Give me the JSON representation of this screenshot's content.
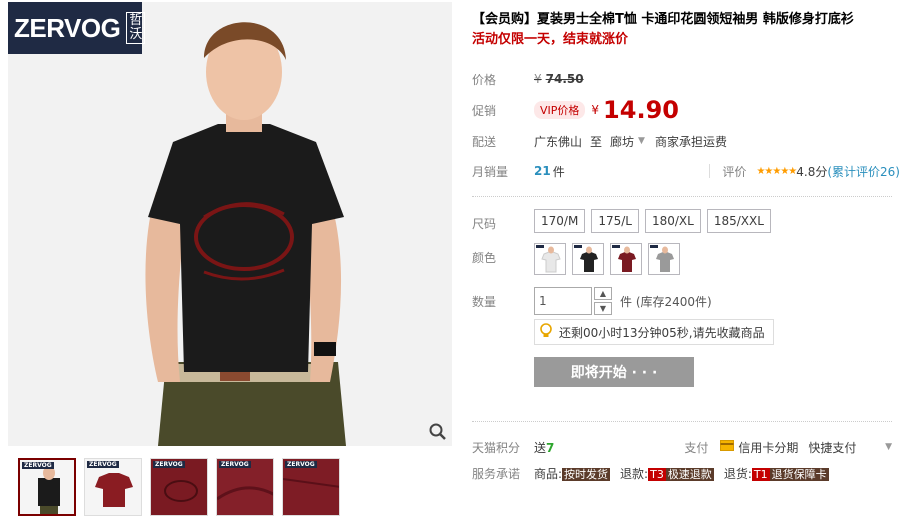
{
  "brand": {
    "logo_text": "ZERVOG",
    "logo_cn": "哲沃"
  },
  "thumbnails": [
    {
      "name": "thumb-front-model",
      "active": true
    },
    {
      "name": "thumb-shirt-flat",
      "active": false
    },
    {
      "name": "thumb-print-detail",
      "active": false
    },
    {
      "name": "thumb-fabric-detail",
      "active": false
    },
    {
      "name": "thumb-hem-detail",
      "active": false
    }
  ],
  "product": {
    "title": "【会员购】夏装男士全棉T恤 卡通印花圆领短袖男 韩版修身打底衫",
    "subtitle": "活动仅限一天，结束就涨价"
  },
  "price": {
    "label": "价格",
    "currency": "¥",
    "original": "74.50"
  },
  "promo": {
    "label": "促销",
    "vip_tag": "VIP价格",
    "currency": "¥",
    "sale": "14.90"
  },
  "shipping": {
    "label": "配送",
    "from": "广东佛山",
    "to_word": "至",
    "to_city": "廊坊",
    "fee_note": "商家承担运费"
  },
  "sales": {
    "label": "月销量",
    "count": "21",
    "unit": "件",
    "review_label": "评价",
    "stars": "★★★★★",
    "rating": "4.8分",
    "review_count": "(累计评价26)"
  },
  "sizes": {
    "label": "尺码",
    "options": [
      "170/M",
      "175/L",
      "180/XL",
      "185/XXL"
    ]
  },
  "colors": {
    "label": "颜色",
    "options": [
      {
        "name": "white",
        "hex": "#e8e8e8"
      },
      {
        "name": "black",
        "hex": "#222222"
      },
      {
        "name": "burgundy",
        "hex": "#7a1a22"
      },
      {
        "name": "gray",
        "hex": "#9a9a9a"
      }
    ]
  },
  "quantity": {
    "label": "数量",
    "value": "1",
    "stock_text": "件 (库存2400件)"
  },
  "tip": {
    "text": "还剩00小时13分钟05秒,请先收藏商品"
  },
  "buy_button": {
    "label": "即将开始 · · ·"
  },
  "points": {
    "label": "天猫积分",
    "text_prefix": "送",
    "value": "7"
  },
  "payment": {
    "label": "支付",
    "credit": "信用卡分期",
    "express": "快捷支付"
  },
  "services": {
    "label": "服务承诺",
    "items": [
      {
        "prefix": "商品:",
        "badge": "按时发货",
        "red": false
      },
      {
        "prefix": "退款:",
        "badge": "T3",
        "badge2": "极速退款",
        "red": true
      },
      {
        "prefix": "退货:",
        "badge": "T1",
        "badge2": "退货保障卡",
        "red": true
      }
    ]
  }
}
